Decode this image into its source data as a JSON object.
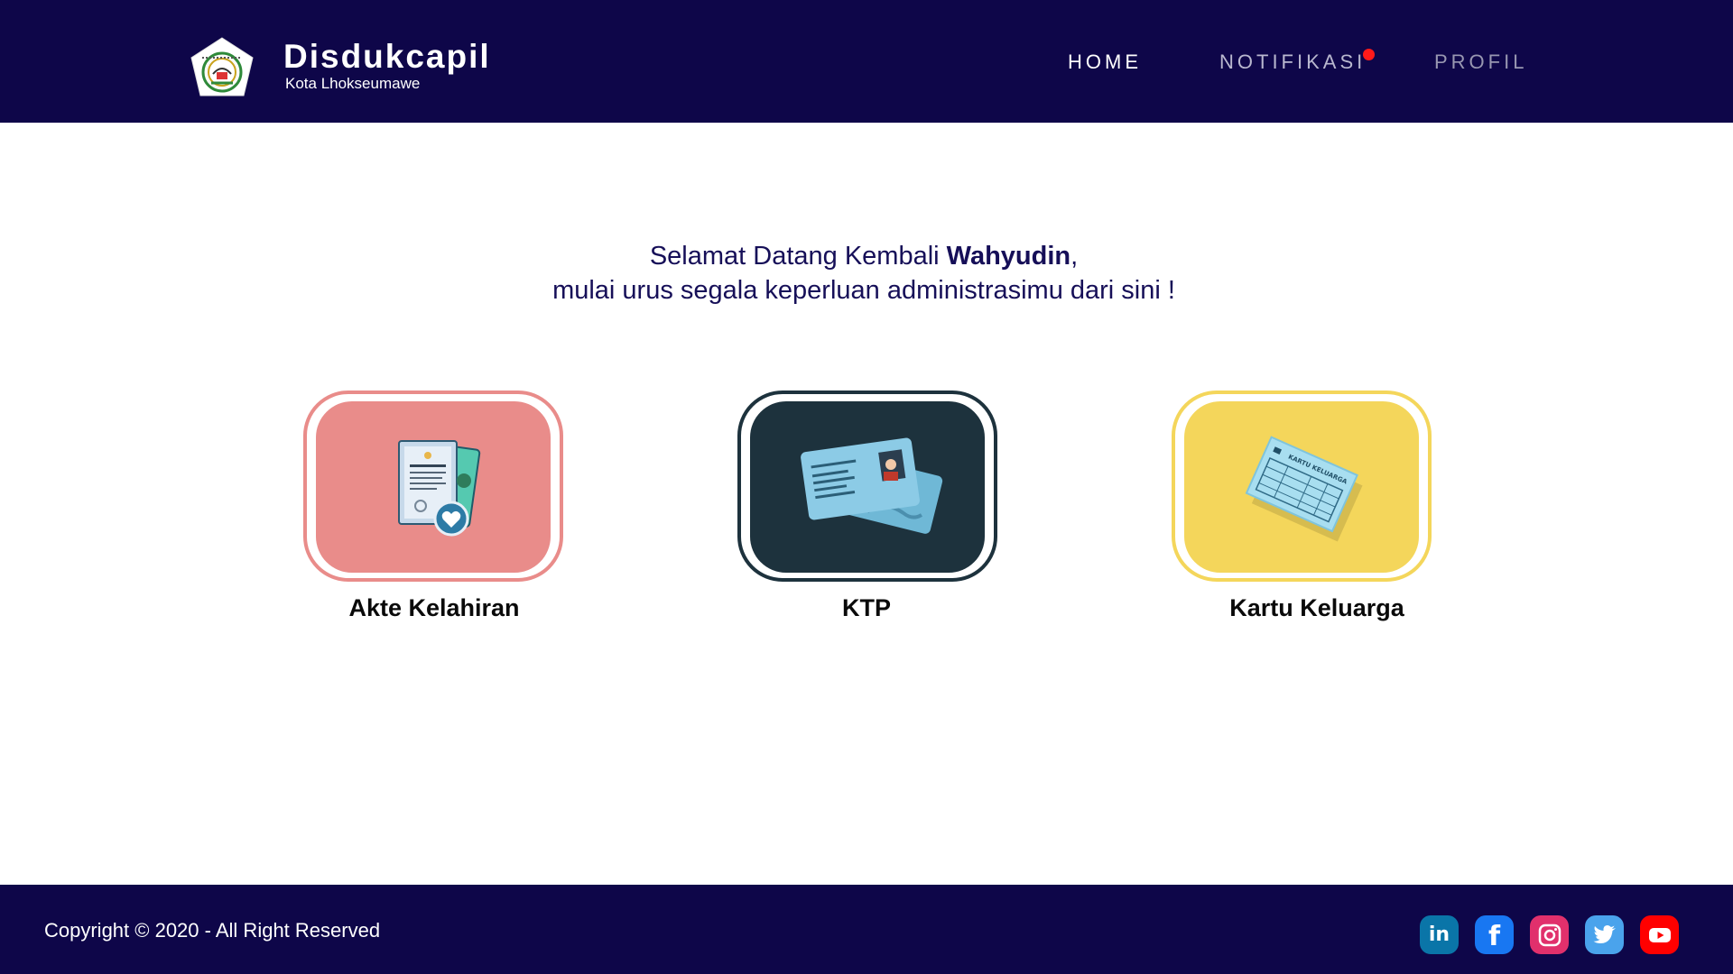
{
  "header": {
    "brand_name": "Disdukcapil",
    "brand_sub": "Kota Lhokseumawe",
    "nav": {
      "home": "HOME",
      "notifikasi": "NOTIFIKASI",
      "profil": "PROFIL"
    }
  },
  "welcome": {
    "line1_prefix": "Selamat Datang Kembali ",
    "user_name": "Wahyudin",
    "line1_suffix": ",",
    "line2": "mulai urus segala keperluan administrasimu dari sini !"
  },
  "services": [
    {
      "label": "Akte Kelahiran",
      "color": "#e98c8a",
      "icon": "birth-certificate-icon"
    },
    {
      "label": "KTP",
      "color": "#1d323d",
      "icon": "id-card-icon"
    },
    {
      "label": "Kartu Keluarga",
      "color": "#f4d65b",
      "icon": "family-card-icon",
      "card_text": "KARTU KELUARGA"
    }
  ],
  "footer": {
    "copyright": "Copyright © 2020 - All Right Reserved",
    "social": [
      {
        "icon": "linkedin-icon",
        "color": "#0a75a8",
        "glyph": "in"
      },
      {
        "icon": "facebook-icon",
        "color": "#1877f2",
        "glyph": "f"
      },
      {
        "icon": "instagram-icon",
        "color": "#e1306c"
      },
      {
        "icon": "twitter-icon",
        "color": "#4aa3ec"
      },
      {
        "icon": "youtube-icon",
        "color": "#ff0000"
      }
    ]
  },
  "colors": {
    "navy": "#0e0649",
    "notification_dot": "#ff1a1a"
  }
}
